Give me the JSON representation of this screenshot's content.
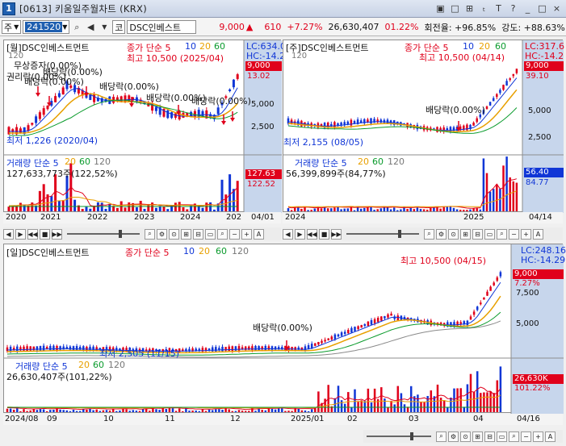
{
  "window": {
    "number": "1",
    "title": "[0613] 키움일주월차트 (KRX)",
    "controls": [
      "▣",
      "□",
      "⊞",
      "ₜ",
      "T",
      "?",
      "_",
      "□",
      "×"
    ]
  },
  "toolbar": {
    "market": "주",
    "code": "241520",
    "type_label": "코",
    "name": "DSC인베스트",
    "price": "9,000",
    "arrow": "▲",
    "change": "610",
    "change_pct": "+7.27%",
    "volume": "26,630,407",
    "volume_pct": "01.22%",
    "turnover": "회전율: +96.85%",
    "strength": "강도: +88.63%"
  },
  "monthly": {
    "title": "[월]DSC인베스트먼트",
    "ma_label": "종가 단순 5",
    "ma_periods": [
      "10",
      "20",
      "60"
    ],
    "lc": "LC:634.0",
    "hc": "HC:-14.2",
    "price_badge": "9,000",
    "price_badge2": "13.02",
    "y_top": "120",
    "y_ticks": [
      "5,000",
      "2,500"
    ],
    "high_label": "최고 10,500 (2025/04)",
    "low_label": "최저 1,226 (2020/04)",
    "events": [
      "무상증자(0.00%)",
      "배당락(0.00%)",
      "권리락(0.00%)",
      "배당락(0.00%)",
      "배당락(0.00%)",
      "배당락(0.00%)",
      "배당락(0.00%)"
    ],
    "vol_title": "거래량 단순 5",
    "vol_ma": [
      "20",
      "60",
      "120"
    ],
    "vol_value": "127,633,773주(122,52%)",
    "vol_badge": "127.63",
    "vol_badge2": "122.52",
    "dates": [
      "2020",
      "2021",
      "2022",
      "2023",
      "2024",
      "202"
    ],
    "axis_date": "04/01"
  },
  "weekly": {
    "title": "[주]DSC인베스트먼트",
    "ma_label": "종가 단순 5",
    "ma_periods": [
      "10",
      "20",
      "60"
    ],
    "lc": "LC:317.6",
    "hc": "HC:-14.2",
    "price_badge": "9,000",
    "price_badge2": "39.10",
    "y_top": "120",
    "y_ticks": [
      "5,000",
      "2,500"
    ],
    "high_label": "최고 10,500 (04/14)",
    "low_label": "최저 2,155 (08/05)",
    "events": [
      "배당락(0.00%)"
    ],
    "vol_title": "거래량 단순 5",
    "vol_ma": [
      "20",
      "60",
      "120"
    ],
    "vol_value": "56,399,899주(84,77%)",
    "vol_badge": "56.40",
    "vol_badge2": "84.77",
    "dates": [
      "2024",
      "2025"
    ],
    "axis_date": "04/14"
  },
  "daily": {
    "title": "[일]DSC인베스트먼트",
    "ma_label": "종가 단순 5",
    "ma_periods": [
      "10",
      "20",
      "60",
      "120"
    ],
    "lc": "LC:248.16",
    "hc": "HC:-14.29",
    "price_badge": "9,000",
    "pct_badge": "7.27%",
    "y_ticks": [
      "7,500",
      "5,000"
    ],
    "high_label": "최고 10,500 (04/15)",
    "low_label": "최저 2,505 (11/15)",
    "events": [
      "배당락(0.00%)"
    ],
    "vol_title": "거래량 단순 5",
    "vol_ma": [
      "20",
      "60",
      "120"
    ],
    "vol_value": "26,630,407주(101,22%)",
    "vol_badge": "26,630K",
    "vol_badge2": "101.22%",
    "dates": [
      "2024/08",
      "09",
      "10",
      "11",
      "12",
      "2025/01",
      "02",
      "03",
      "04"
    ],
    "axis_date": "04/16"
  },
  "controls": {
    "buttons": [
      "◀",
      "▶",
      "◀◀",
      "■",
      "▶▶"
    ],
    "tools": [
      "⌕",
      "⚙",
      "⊙",
      "⊞",
      "⊟",
      "▭",
      "⌕",
      "−",
      "+",
      "A"
    ]
  },
  "colors": {
    "up": "#e0001b",
    "down": "#1036d6",
    "ma5": "#e0001b",
    "ma10": "#1036d6",
    "ma20": "#e8a000",
    "ma60": "#0a9b2c",
    "ma120": "#8a8a8a",
    "axis_bg": "#c7d6ec"
  }
}
